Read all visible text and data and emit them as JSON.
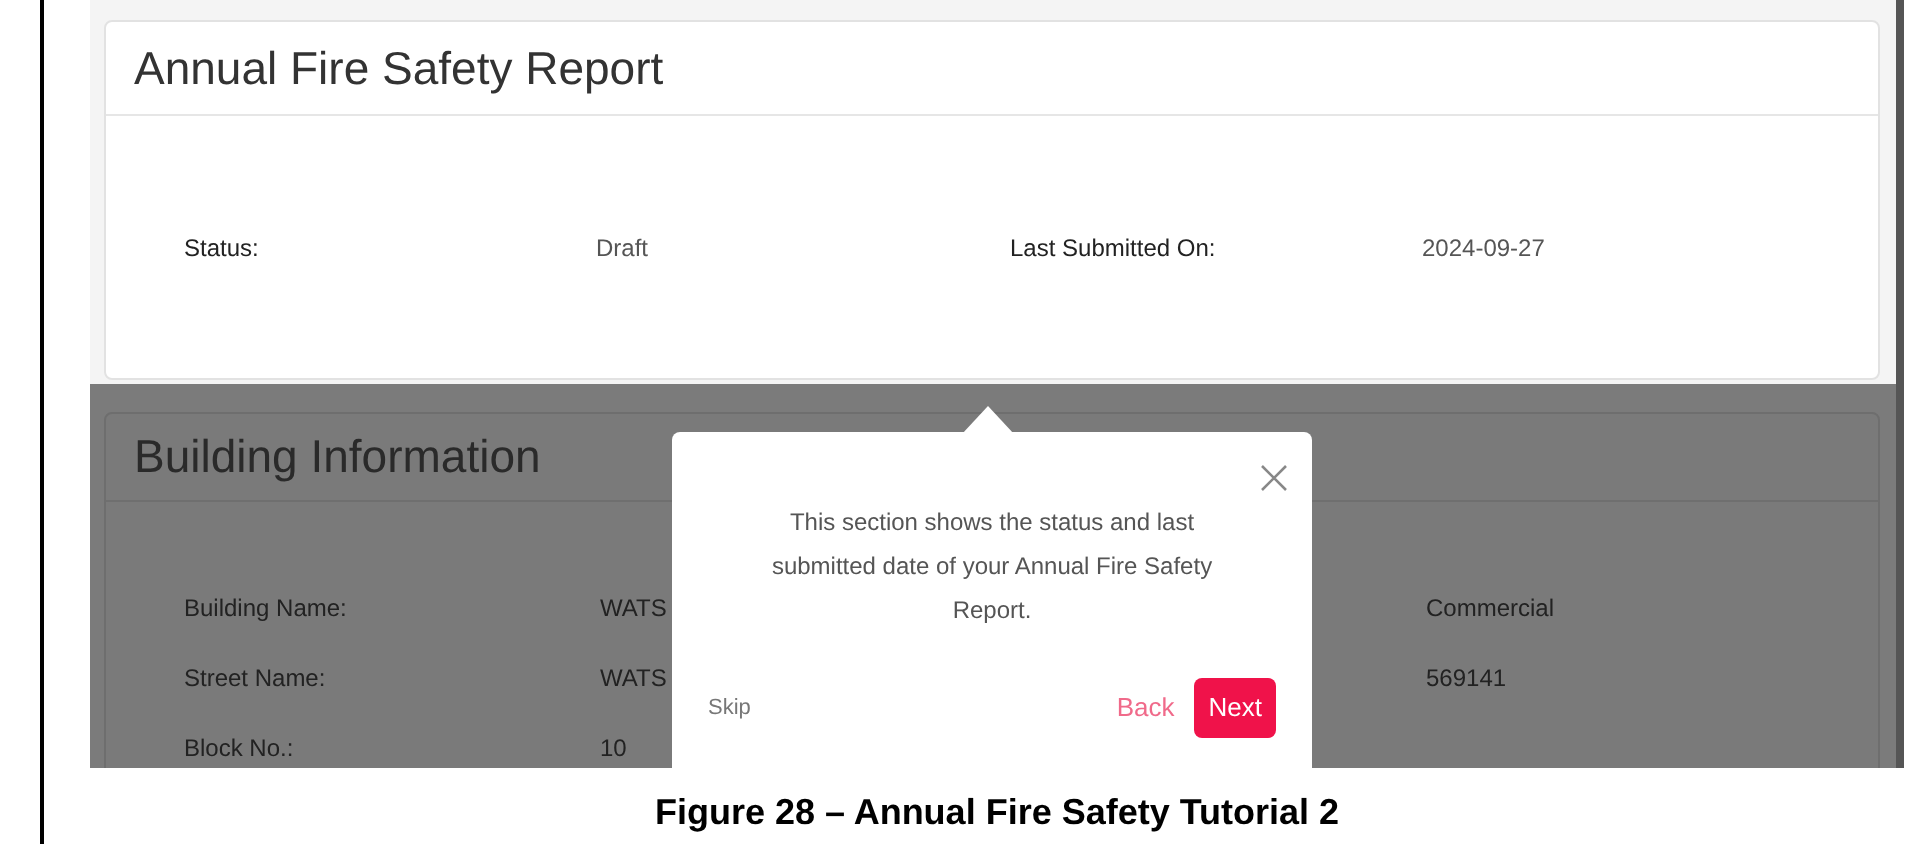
{
  "report_card": {
    "title": "Annual Fire Safety Report",
    "fields": [
      {
        "label": "Status:",
        "value": "Draft"
      },
      {
        "label": "Last Submitted On:",
        "value": "2024-09-27"
      }
    ]
  },
  "building_card": {
    "title": "Building Information",
    "rows": [
      {
        "label": "Building Name:",
        "value": "WATS",
        "column_3": "Commercial"
      },
      {
        "label": "Street Name:",
        "value": "WATS",
        "column_3": "569141"
      },
      {
        "label": "Block No.:",
        "value": "10"
      }
    ]
  },
  "tour_popover": {
    "text": "This section shows the status and last submitted date of your Annual Fire Safety Report.",
    "skip": "Skip",
    "back": "Back",
    "next": "Next"
  },
  "caption": "Figure 28 – Annual Fire Safety Tutorial 2"
}
